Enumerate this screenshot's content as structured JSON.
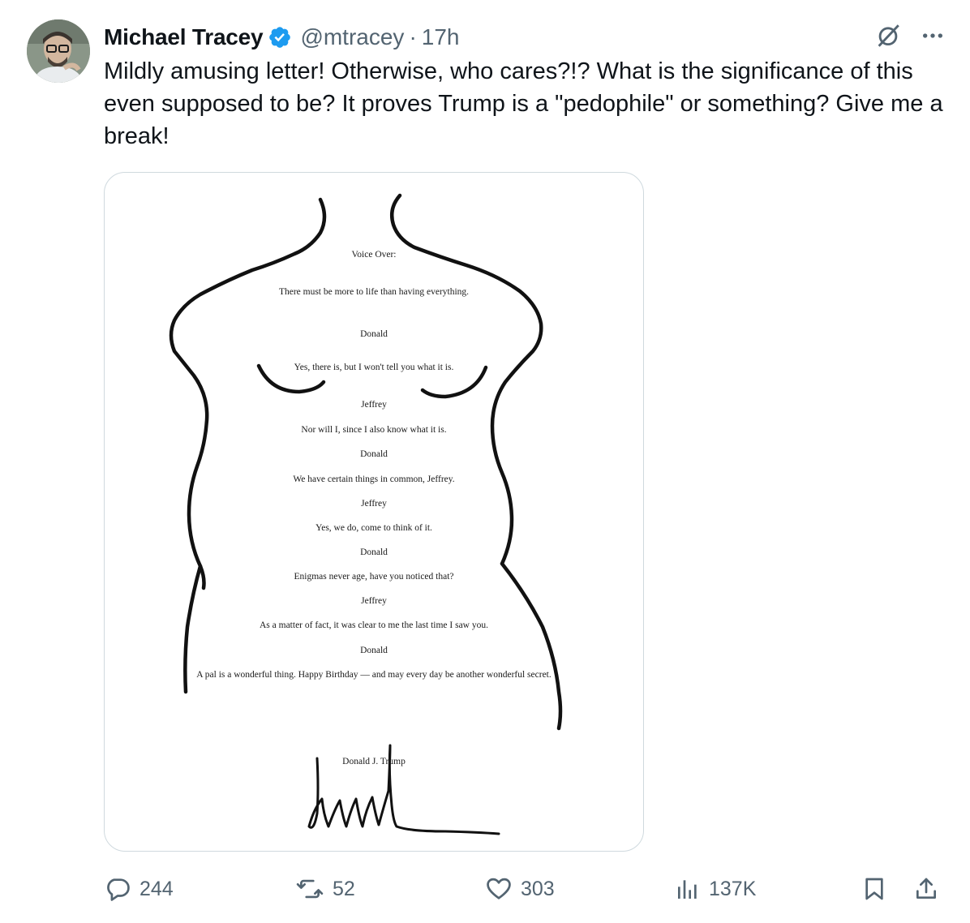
{
  "tweet": {
    "author": {
      "name": "Michael Tracey",
      "handle": "@mtracey",
      "verified": true,
      "avatar_icon": "avatar-photo"
    },
    "separator": "·",
    "time": "17h",
    "text": "Mildly amusing letter! Otherwise, who cares?!? What is the significance of this even supposed to be? It proves Trump is a \"pedophile\" or something? Give me a break!",
    "header_icons": [
      "grok-icon",
      "more-icon"
    ]
  },
  "letter": {
    "lines": [
      "Voice Over:",
      "There must be more to life than having everything.",
      "Donald",
      "Yes, there is, but I won't tell you what it is.",
      "Jeffrey",
      "Nor will I, since I also know what it is.",
      "Donald",
      "We have certain things in common, Jeffrey.",
      "Jeffrey",
      "Yes, we do, come to think of it.",
      "Donald",
      "Enigmas never age, have you noticed that?",
      "Jeffrey",
      "As a matter of fact, it was clear to me the last time I saw you.",
      "Donald",
      "A pal is a wonderful thing. Happy Birthday — and may every day be another wonderful secret.",
      "Donald J. Trump"
    ]
  },
  "actions": {
    "replies": "244",
    "reposts": "52",
    "likes": "303",
    "views": "137K"
  },
  "colors": {
    "text": "#0f1419",
    "secondary": "#536471",
    "verified": "#1d9bf0",
    "border": "#cfd9de"
  }
}
